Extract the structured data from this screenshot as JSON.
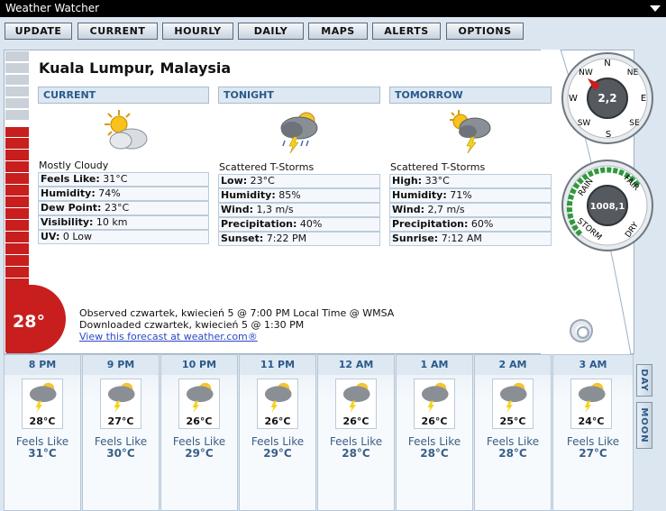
{
  "app": {
    "title": "Weather Watcher"
  },
  "toolbar": {
    "buttons": [
      "UPDATE",
      "CURRENT",
      "HOURLY",
      "DAILY",
      "MAPS",
      "ALERTS",
      "OPTIONS"
    ]
  },
  "location": "Kuala Lumpur, Malaysia",
  "current": {
    "header": "CURRENT",
    "condition": "Mostly Cloudy",
    "rows": [
      {
        "label": "Feels Like:",
        "value": "31°C"
      },
      {
        "label": "Humidity:",
        "value": "74%"
      },
      {
        "label": "Dew Point:",
        "value": "23°C"
      },
      {
        "label": "Visibility:",
        "value": "10 km"
      },
      {
        "label": "UV:",
        "value": "0 Low"
      }
    ]
  },
  "tonight": {
    "header": "TONIGHT",
    "condition": "Scattered T-Storms",
    "rows": [
      {
        "label": "Low:",
        "value": "23°C"
      },
      {
        "label": "Humidity:",
        "value": "85%"
      },
      {
        "label": "Wind:",
        "value": "1,3 m/s"
      },
      {
        "label": "Precipitation:",
        "value": "40%"
      },
      {
        "label": "Sunset:",
        "value": "7:22 PM"
      }
    ]
  },
  "tomorrow": {
    "header": "TOMORROW",
    "condition": "Scattered T-Storms",
    "rows": [
      {
        "label": "High:",
        "value": "33°C"
      },
      {
        "label": "Humidity:",
        "value": "71%"
      },
      {
        "label": "Wind:",
        "value": "2,7 m/s"
      },
      {
        "label": "Precipitation:",
        "value": "60%"
      },
      {
        "label": "Sunrise:",
        "value": "7:12 AM"
      }
    ]
  },
  "thermometer": {
    "temp": "28°"
  },
  "compass": {
    "value": "2,2",
    "n": "N",
    "ne": "NE",
    "e": "E",
    "se": "SE",
    "s": "S",
    "sw": "SW",
    "w": "W",
    "nw": "NW"
  },
  "barometer": {
    "value": "1008,1",
    "rain": "RAIN",
    "fair": "FAIR",
    "storm": "STORM",
    "dry": "DRY"
  },
  "observed": "Observed czwartek, kwiecień 5 @ 7:00 PM Local Time @ WMSA",
  "downloaded": "Downloaded czwartek, kwiecień 5 @ 1:30 PM",
  "forecast_link": "View this forecast at weather.com®",
  "feels_like_label": "Feels Like",
  "hourly": [
    {
      "time": "8 PM",
      "temp": "28°C",
      "feels": "31°C"
    },
    {
      "time": "9 PM",
      "temp": "27°C",
      "feels": "30°C"
    },
    {
      "time": "10 PM",
      "temp": "26°C",
      "feels": "29°C"
    },
    {
      "time": "11 PM",
      "temp": "26°C",
      "feels": "29°C"
    },
    {
      "time": "12 AM",
      "temp": "26°C",
      "feels": "28°C"
    },
    {
      "time": "1 AM",
      "temp": "26°C",
      "feels": "28°C"
    },
    {
      "time": "2 AM",
      "temp": "25°C",
      "feels": "28°C"
    },
    {
      "time": "3 AM",
      "temp": "24°C",
      "feels": "27°C"
    }
  ],
  "side_tabs": {
    "day": "DAY",
    "moon": "MOON"
  },
  "colors": {
    "thermo_red": "#c81e1e",
    "header_blue": "#2a5a8c",
    "gauge_green": "#2e9a3a"
  },
  "icons": {
    "current": "partly-cloudy-sun-icon",
    "tonight": "thunderstorm-icon",
    "tomorrow": "scattered-tstorm-sun-icon",
    "hourly": "thunderstorm-icon"
  }
}
